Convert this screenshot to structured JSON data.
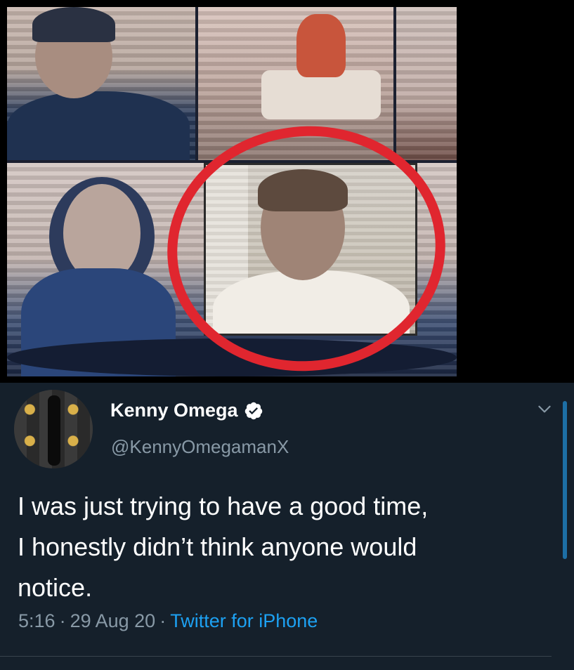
{
  "tweet": {
    "display_name": "Kenny Omega",
    "handle": "@KennyOmegamanX",
    "verified": true,
    "text_lines": [
      "I was just trying to have a good time,",
      "I honestly didn’t think anyone would",
      "notice."
    ],
    "time": "5:16",
    "date": "29 Aug 20",
    "separator": "·",
    "source": "Twitter for iPhone"
  },
  "icons": {
    "verified": "verified-badge-icon",
    "menu": "chevron-down-icon"
  },
  "colors": {
    "background": "#15202b",
    "accent": "#1da1f2",
    "secondary_text": "#8899a6",
    "highlight_circle": "#e0262f"
  }
}
